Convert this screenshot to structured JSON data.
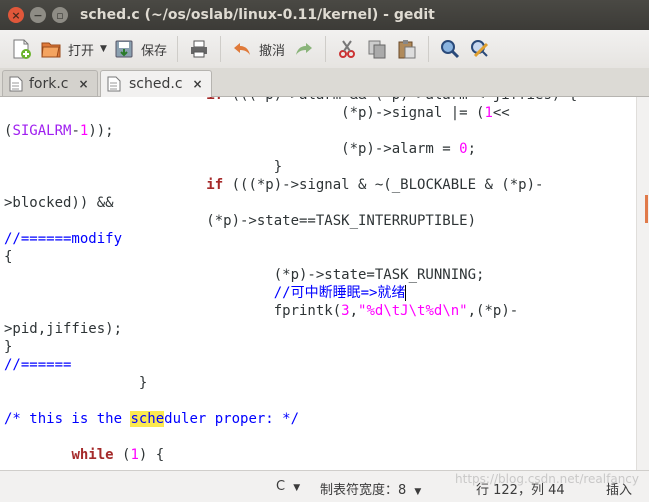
{
  "window": {
    "title": "sched.c (~/os/oslab/linux-0.11/kernel) - gedit"
  },
  "toolbar": {
    "new_icon": "new-document-icon",
    "open_label": "打开",
    "save_label": "保存",
    "undo_label": "撤消"
  },
  "tabs": [
    {
      "label": "fork.c",
      "active": false
    },
    {
      "label": "sched.c",
      "active": true
    }
  ],
  "code_lines": [
    "\t\t\tif (((*p)->alarm && (*p)->alarm < jiffies) {",
    "\t\t\t\t\t(*p)->signal |= (1<<",
    "(SIGALRM-1));",
    "\t\t\t\t\t(*p)->alarm = 0;",
    "\t\t\t\t}",
    "\t\t\tif (((*p)->signal & ~(_BLOCKABLE & (*p)-",
    ">blocked)) &&",
    "\t\t\t(*p)->state==TASK_INTERRUPTIBLE)",
    "//======modify",
    "{",
    "\t\t\t\t(*p)->state=TASK_RUNNING;",
    "\t\t\t\t//可中断睡眠=>就绪",
    "\t\t\t\tfprintk(3,\"%d\\tJ\\t%d\\n\",(*p)-",
    ">pid,jiffies);",
    "}",
    "//======",
    "\t\t}",
    "",
    "/* this is the scheduler proper: */",
    "",
    "\twhile (1) {"
  ],
  "search_highlight": "sche",
  "status": {
    "language": "C",
    "tab_width": "制表符宽度：8",
    "position": "行 122，列 44",
    "mode": "插入"
  },
  "watermark": "https://blog.csdn.net/realfancy",
  "colors": {
    "title_bg": "#3c3b37",
    "close_btn": "#e0573a",
    "keyword": "#a52a2a",
    "comment": "#0000ff",
    "number": "#ff00ff"
  }
}
